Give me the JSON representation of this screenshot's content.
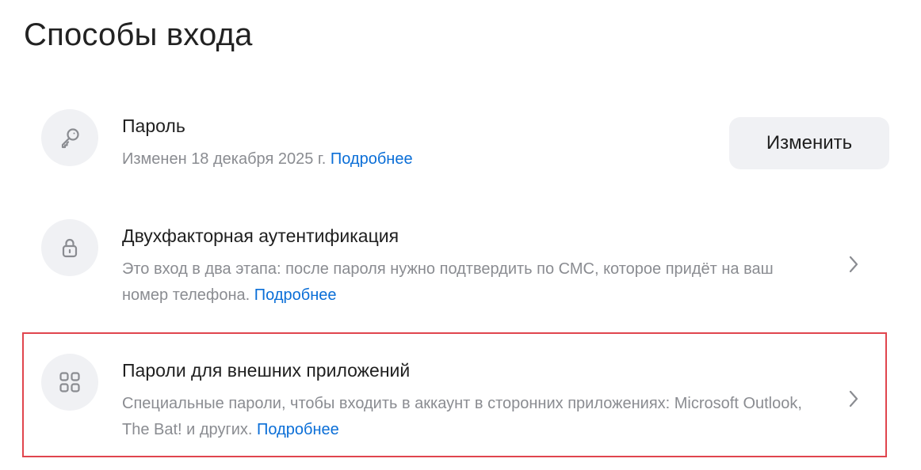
{
  "page_title": "Способы входа",
  "rows": [
    {
      "title": "Пароль",
      "description": "Изменен 18 декабря 2025 г.",
      "link": "Подробнее",
      "icon": "key-icon",
      "button_label": "Изменить"
    },
    {
      "title": "Двухфакторная аутентификация",
      "description": "Это вход в два этапа: после пароля нужно подтвердить по СМС, которое придёт на ваш номер телефона.",
      "link": "Подробнее",
      "icon": "lock-icon"
    },
    {
      "title": "Пароли для внешних приложений",
      "description": "Специальные пароли, чтобы входить в аккаунт в сторонних приложениях: Microsoft Outlook, The Bat! и других.",
      "link": "Подробнее",
      "icon": "grid-icon"
    }
  ],
  "colors": {
    "link": "#0a6ed7",
    "highlight": "#e0454e",
    "icon_bg": "#f0f1f4",
    "muted_text": "#8a8c91"
  }
}
